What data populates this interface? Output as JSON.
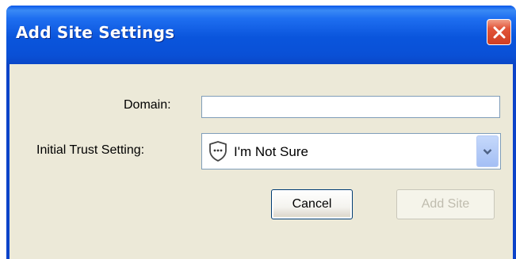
{
  "window": {
    "title": "Add Site Settings"
  },
  "form": {
    "domain_label": "Domain:",
    "domain_value": "",
    "trust_label": "Initial Trust Setting:",
    "trust_selected": "I'm Not Sure",
    "trust_icon": "shield-icon"
  },
  "buttons": {
    "cancel_label": "Cancel",
    "add_site_label": "Add Site",
    "add_site_enabled": false
  },
  "colors": {
    "titlebar": "#0a55dc",
    "window_body": "#ece9d8",
    "close_button": "#e2563a",
    "field_border": "#7f9db9"
  }
}
